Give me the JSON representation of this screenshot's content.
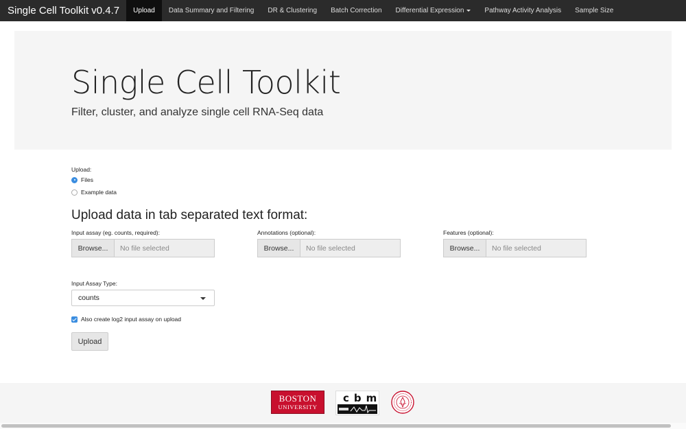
{
  "navbar": {
    "brand": "Single Cell Toolkit v0.4.7",
    "tabs": [
      {
        "label": "Upload",
        "active": true
      },
      {
        "label": "Data Summary and Filtering"
      },
      {
        "label": "DR & Clustering"
      },
      {
        "label": "Batch Correction"
      },
      {
        "label": "Differential Expression",
        "dropdown": true
      },
      {
        "label": "Pathway Activity Analysis"
      },
      {
        "label": "Sample Size"
      }
    ]
  },
  "jumbotron": {
    "title": "Single Cell Toolkit",
    "subtitle": "Filter, cluster, and analyze single cell RNA-Seq data"
  },
  "upload": {
    "label": "Upload:",
    "options": [
      {
        "label": "Files",
        "selected": true
      },
      {
        "label": "Example data",
        "selected": false
      }
    ]
  },
  "section": {
    "heading": "Upload data in tab separated text format:"
  },
  "files": {
    "assay": {
      "label": "Input assay (eg. counts, required):",
      "button": "Browse...",
      "placeholder": "No file selected"
    },
    "annotations": {
      "label": "Annotations (optional):",
      "button": "Browse...",
      "placeholder": "No file selected"
    },
    "features": {
      "label": "Features (optional):",
      "button": "Browse...",
      "placeholder": "No file selected"
    }
  },
  "assay_type": {
    "label": "Input Assay Type:",
    "selected": "counts"
  },
  "log2_option": {
    "label": "Also create log2 input assay on upload",
    "checked": true
  },
  "upload_button": {
    "label": "Upload"
  },
  "footer": {
    "bu_line1": "BOSTON",
    "bu_line2": "UNIVERSITY",
    "cbm_text": "cbm",
    "colors": {
      "bu_red": "#c8102e",
      "accent_blue": "#3a8de0"
    }
  }
}
